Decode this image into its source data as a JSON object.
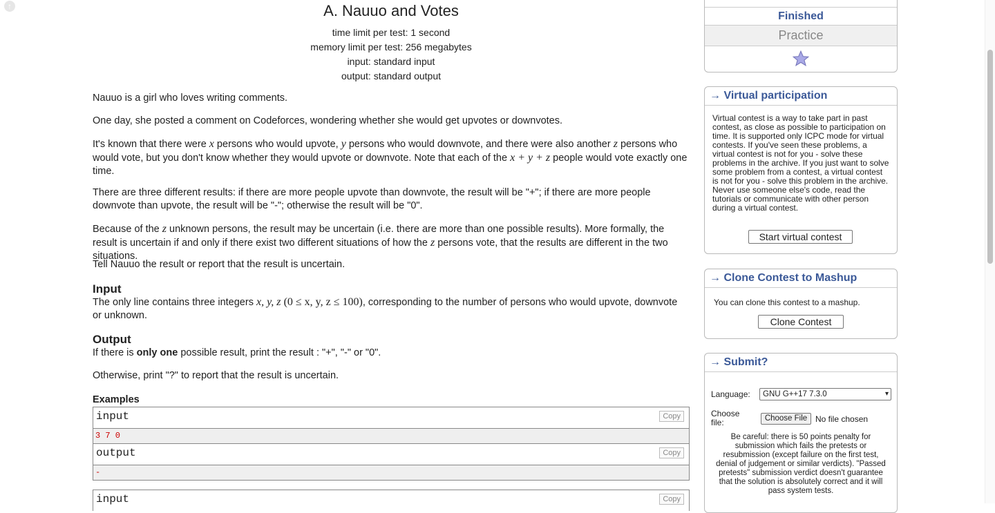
{
  "page": {
    "scroll_up_icon": "arrow-up-icon"
  },
  "problem": {
    "title": "A. Nauuo and Votes",
    "time_limit": "time limit per test: 1 second",
    "memory_limit": "memory limit per test: 256 megabytes",
    "input_file": "input: standard input",
    "output_file": "output: standard output",
    "p1": "Nauuo is a girl who loves writing comments.",
    "p2": "One day, she posted a comment on Codeforces, wondering whether she would get upvotes or downvotes.",
    "p3": {
      "a": "It's known that there were ",
      "x": "x",
      "b": " persons who would upvote, ",
      "y": "y",
      "c": " persons who would downvote, and there were also another ",
      "z": "z",
      "d": " persons who would vote, but you don't know whether they would upvote or downvote. Note that each of the ",
      "sum": "x + y + z",
      "e": " people would vote exactly one time."
    },
    "p4": "There are three different results: if there are more people upvote than downvote, the result will be \"+\"; if there are more people downvote than upvote, the result will be \"-\"; otherwise the result will be \"0\".",
    "p5": {
      "a": "Because of the ",
      "z": "z",
      "b": " unknown persons, the result may be uncertain (i.e. there are more than one possible results). More formally, the result is uncertain if and only if there exist two different situations of how the ",
      "z2": "z",
      "c": " persons vote, that the results are different in the two situations."
    },
    "p6": "Tell Nauuo the result or report that the result is uncertain.",
    "input_header": "Input",
    "input_text": {
      "a": "The only line contains three integers ",
      "vars": "x, y, z",
      "range": "(0 ≤ x, y, z ≤ 100)",
      "b": ", corresponding to the number of persons who would upvote, downvote or unknown."
    },
    "output_header": "Output",
    "output_text": {
      "a": "If there is ",
      "bold": "only one",
      "b": " possible result, print the result : \"+\", \"-\" or \"0\"."
    },
    "output_text2": "Otherwise, print \"?\" to report that the result is uncertain.",
    "examples_header": "Examples",
    "examples": [
      {
        "input_label": "input",
        "input_value": "3 7 0",
        "output_label": "output",
        "output_value": "-",
        "copy": "Copy"
      },
      {
        "input_label": "input",
        "copy": "Copy"
      }
    ]
  },
  "sidebar": {
    "contest": {
      "status": "Finished",
      "mode": "Practice",
      "star_icon": "star-icon"
    },
    "virtual": {
      "title": "→ Virtual participation",
      "text": "Virtual contest is a way to take part in past contest, as close as possible to participation on time. It is supported only ICPC mode for virtual contests. If you've seen these problems, a virtual contest is not for you - solve these problems in the archive. If you just want to solve some problem from a contest, a virtual contest is not for you - solve this problem in the archive. Never use someone else's code, read the tutorials or communicate with other person during a virtual contest.",
      "button": "Start virtual contest"
    },
    "clone": {
      "title": "→ Clone Contest to Mashup",
      "text": "You can clone this contest to a mashup.",
      "button": "Clone Contest"
    },
    "submit": {
      "title": "→ Submit?",
      "language_label": "Language:",
      "language_value": "GNU G++17 7.3.0",
      "file_label": "Choose file:",
      "file_button": "Choose File",
      "file_status": "No file chosen",
      "warning": "Be careful: there is 50 points penalty for submission which fails the pretests or resubmission (except failure on the first test, denial of judgement or similar verdicts). \"Passed pretests\" submission verdict doesn't guarantee that the solution is absolutely correct and it will pass system tests."
    }
  },
  "colors": {
    "link": "#3b5998",
    "example_value": "#cc0000"
  }
}
